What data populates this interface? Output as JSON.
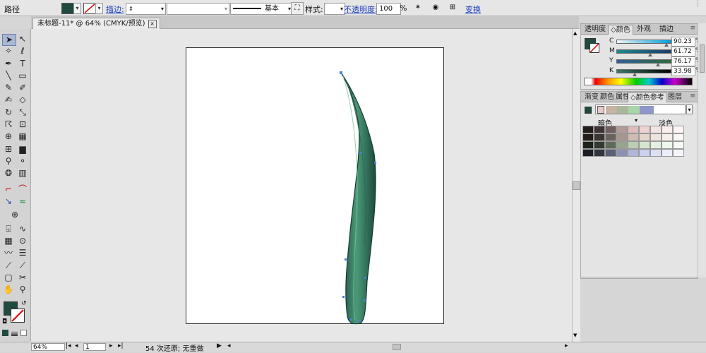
{
  "control_bar": {
    "object_type": "路径",
    "stroke_label": "描边:",
    "stroke_profile": "基本",
    "style_label": "样式:",
    "opacity_label": "不透明度:",
    "opacity_value": "100",
    "opacity_unit": "%",
    "transform_label": "变换",
    "fill_color": "#1f4a3f"
  },
  "document": {
    "tab_title": "未标题-11* @ 64% (CMYK/预览)",
    "close_glyph": "×"
  },
  "panels": {
    "color_panel": {
      "tabs": [
        "透明度",
        "颜色",
        "外观",
        "描边"
      ],
      "active_tab": 1,
      "channels": [
        {
          "key": "C",
          "value": "90.23",
          "unit": "%",
          "level": 0.9023,
          "bar_from": "#ffffff",
          "bar_to": "#00a0e0"
        },
        {
          "key": "M",
          "value": "61.72",
          "unit": "%",
          "level": 0.6172,
          "bar_from": "#1a8a8a",
          "bar_to": "#1a3a6a"
        },
        {
          "key": "Y",
          "value": "76.17",
          "unit": "%",
          "level": 0.7617,
          "bar_from": "#2f5f9a",
          "bar_to": "#2f6a3a"
        },
        {
          "key": "K",
          "value": "33.98",
          "unit": "%",
          "level": 0.3398,
          "bar_from": "#3a7a6a",
          "bar_to": "#000000"
        }
      ]
    },
    "guide_panel": {
      "tabs": [
        "渐变",
        "颜色",
        "属性",
        "颜色参考",
        "图层"
      ],
      "active_tab": 3,
      "dark_label": "暗色",
      "light_label": "淡色",
      "harmony_colors": [
        "#e9c9c9",
        "#c7b3a3",
        "#a9b89a",
        "#a9d6a9",
        "#8d97c9"
      ]
    }
  },
  "status_bar": {
    "zoom": "64%",
    "page": "1",
    "status_text": "54 次还原; 无重做"
  }
}
